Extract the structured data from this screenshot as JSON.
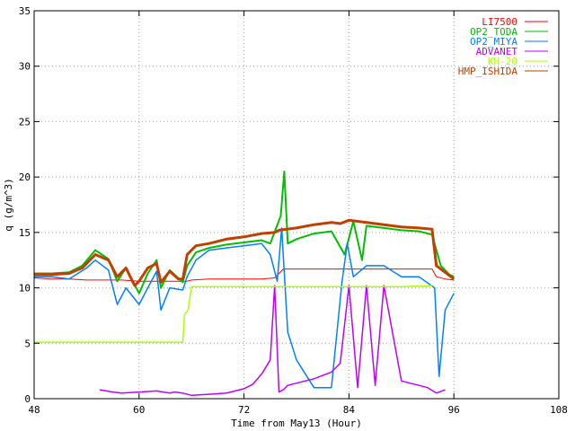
{
  "chart_data": {
    "type": "line",
    "title": "",
    "xlabel": "Time from May13 (Hour)",
    "ylabel": "q (g/m^3)",
    "xlim": [
      48,
      108
    ],
    "ylim": [
      0,
      35
    ],
    "xticks": [
      48,
      60,
      72,
      84,
      96,
      108
    ],
    "yticks": [
      0,
      5,
      10,
      15,
      20,
      25,
      30,
      35
    ],
    "xtick_labels": [
      "48",
      "60",
      "72",
      "84",
      "96",
      "108"
    ],
    "ytick_labels": [
      "0",
      "5",
      "10",
      "15",
      "20",
      "25",
      "30",
      "35"
    ],
    "grid": true,
    "legend_position": "top-right",
    "series": [
      {
        "name": "LI7500",
        "color": "#ff0000",
        "x": [
          48,
          50,
          52,
          54,
          56,
          58,
          60,
          62,
          64,
          65.5,
          66,
          68,
          70,
          72,
          74,
          75.5,
          76.5,
          78,
          80,
          82,
          84,
          86,
          88,
          90,
          92,
          93.5,
          94,
          95,
          96
        ],
        "y": [
          10.9,
          10.8,
          10.8,
          10.7,
          10.7,
          10.7,
          10.6,
          10.6,
          10.6,
          10.6,
          10.7,
          10.8,
          10.8,
          10.8,
          10.8,
          10.9,
          11.7,
          11.7,
          11.7,
          11.7,
          11.7,
          11.7,
          11.7,
          11.7,
          11.7,
          11.7,
          11.0,
          10.8,
          10.7
        ]
      },
      {
        "name": "OP2_TODA",
        "color": "#00c000",
        "x": [
          48,
          50,
          52,
          53.5,
          55,
          56.5,
          57.5,
          58.5,
          60,
          61,
          62,
          62.5,
          63.5,
          65,
          65.5,
          66.5,
          68,
          70,
          72,
          74,
          75,
          76.2,
          76.6,
          77,
          78,
          80,
          82,
          83.5,
          84.5,
          85.5,
          86,
          88,
          90,
          92,
          93.5,
          94.5,
          95.5,
          96
        ],
        "y": [
          11.3,
          11.3,
          11.4,
          12.0,
          13.4,
          12.6,
          10.6,
          11.8,
          9.5,
          11.3,
          12.5,
          10.0,
          11.6,
          10.5,
          12.0,
          13.2,
          13.6,
          13.9,
          14.1,
          14.3,
          14.0,
          16.5,
          20.5,
          14.0,
          14.4,
          14.9,
          15.1,
          13.0,
          16.0,
          12.5,
          15.6,
          15.4,
          15.2,
          15.1,
          14.8,
          12.0,
          11.2,
          11.0
        ]
      },
      {
        "name": "OP2_MIYA",
        "color": "#0080ff",
        "x": [
          48,
          50,
          52,
          54,
          55,
          56.5,
          57.5,
          58.5,
          60,
          61,
          62,
          62.5,
          63.5,
          65,
          65.5,
          66.5,
          68,
          70,
          72,
          74,
          75,
          75.8,
          76.3,
          77,
          78,
          80,
          82,
          83.2,
          83.8,
          84.5,
          86,
          88,
          90,
          92,
          93.8,
          94.3,
          95,
          96
        ],
        "y": [
          11.0,
          11.0,
          10.8,
          11.8,
          12.5,
          11.6,
          8.5,
          10.0,
          8.5,
          10.0,
          11.5,
          8.0,
          10.0,
          9.8,
          11.0,
          12.5,
          13.4,
          13.6,
          13.8,
          14.0,
          13.0,
          10.6,
          15.4,
          6.0,
          3.5,
          1.0,
          1.0,
          10.5,
          14.0,
          11.0,
          12.0,
          12.0,
          11.0,
          11.0,
          10.0,
          2.0,
          8.0,
          9.5
        ]
      },
      {
        "name": "ADVANET",
        "color": "#c000ff",
        "x": [
          55.5,
          57,
          58,
          60,
          62,
          63.5,
          64,
          65,
          66,
          68,
          70,
          72,
          73,
          74,
          75,
          75.5,
          76,
          76.5,
          77,
          78,
          80,
          82,
          83,
          84,
          85,
          86,
          87,
          88,
          90,
          92,
          93,
          94,
          95
        ],
        "y": [
          0.8,
          0.6,
          0.5,
          0.6,
          0.7,
          0.5,
          0.6,
          0.5,
          0.3,
          0.4,
          0.5,
          0.9,
          1.3,
          2.2,
          3.5,
          10.2,
          0.6,
          0.8,
          1.2,
          1.4,
          1.8,
          2.4,
          3.2,
          10.2,
          1.0,
          10.2,
          1.2,
          10.2,
          1.6,
          1.2,
          1.0,
          0.5,
          0.8
        ]
      },
      {
        "name": "KH-20",
        "color": "#aaff00",
        "x": [
          48,
          50,
          55,
          60,
          65,
          65.2,
          65.6,
          66,
          68,
          70,
          75,
          80,
          85,
          90,
          93.5
        ],
        "y": [
          5.1,
          5.1,
          5.1,
          5.1,
          5.1,
          7.6,
          8.0,
          10.1,
          10.1,
          10.1,
          10.1,
          10.1,
          10.1,
          10.1,
          10.2
        ]
      },
      {
        "name": "HMP_ISHIDA",
        "color": "#c04000",
        "x": [
          48,
          50,
          52,
          53.5,
          55,
          56.5,
          57.5,
          58.5,
          59.5,
          60,
          61,
          62,
          62.5,
          63.5,
          64.5,
          65,
          65.5,
          66,
          66.5,
          68,
          70,
          72,
          74,
          75.5,
          76,
          78,
          80,
          82,
          83,
          84,
          86,
          88,
          90,
          92,
          93.5,
          94,
          95,
          96
        ],
        "y": [
          11.2,
          11.2,
          11.3,
          11.8,
          13.0,
          12.5,
          11.0,
          11.8,
          10.2,
          10.6,
          11.8,
          12.2,
          10.5,
          11.5,
          10.8,
          10.8,
          13.0,
          13.4,
          13.8,
          14.0,
          14.4,
          14.6,
          14.9,
          15.0,
          15.2,
          15.4,
          15.7,
          15.9,
          15.8,
          16.1,
          15.9,
          15.7,
          15.5,
          15.4,
          15.3,
          12.0,
          11.4,
          10.8
        ]
      }
    ]
  }
}
